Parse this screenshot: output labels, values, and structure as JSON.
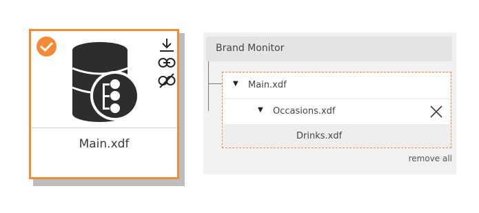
{
  "card": {
    "title": "Main.xdf",
    "icons": [
      "check-icon",
      "database-model-icon",
      "download-icon",
      "link-icon",
      "unlink-icon"
    ],
    "accent_color": "#f28a36"
  },
  "panel": {
    "title": "Brand Monitor",
    "tree": [
      {
        "label": "Main.xdf",
        "expanded": true
      },
      {
        "label": "Occasions.xdf",
        "expanded": true,
        "removable": true
      },
      {
        "label": "Drinks.xdf"
      }
    ],
    "remove_all_label": "remove all"
  }
}
